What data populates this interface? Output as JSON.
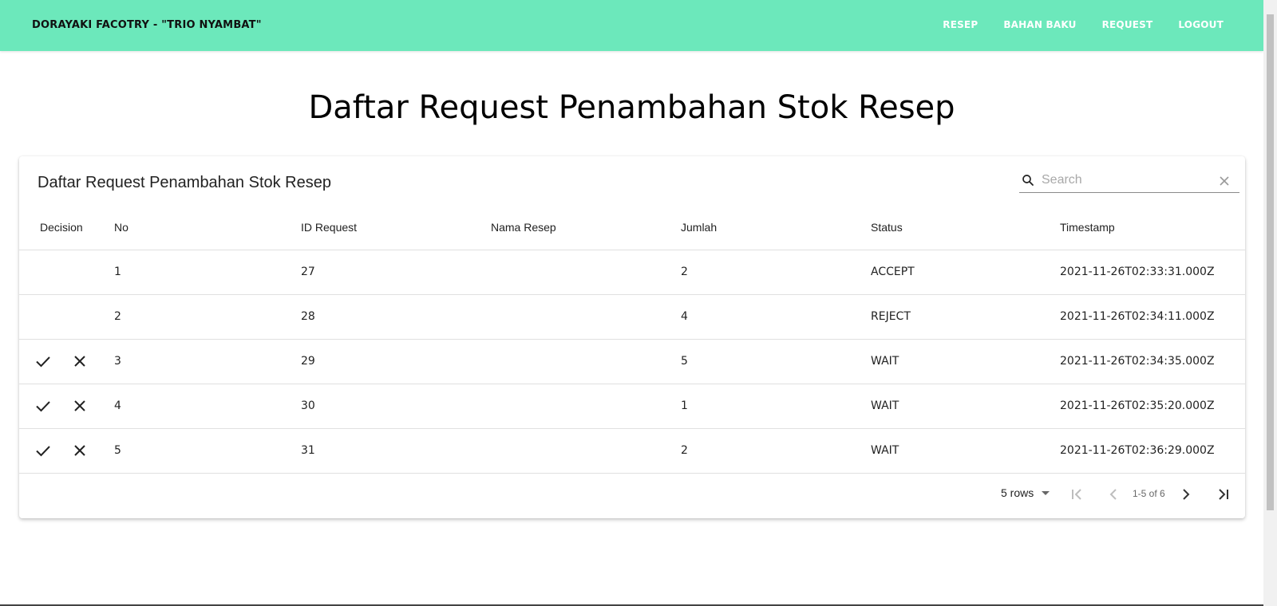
{
  "navbar": {
    "brand": "DORAYAKI FACOTRY - \"TRIO NYAMBAT\"",
    "links": [
      "RESEP",
      "BAHAN BAKU",
      "REQUEST",
      "LOGOUT"
    ]
  },
  "page_title": "Daftar Request Penambahan Stok Resep",
  "table": {
    "title": "Daftar Request Penambahan Stok Resep",
    "search_placeholder": "Search",
    "columns": [
      "Decision",
      "No",
      "ID Request",
      "Nama Resep",
      "Jumlah",
      "Status",
      "Timestamp"
    ],
    "rows": [
      {
        "no": "1",
        "id": "27",
        "nama": "",
        "jumlah": "2",
        "status": "ACCEPT",
        "timestamp": "2021-11-26T02:33:31.000Z",
        "actions": false
      },
      {
        "no": "2",
        "id": "28",
        "nama": "",
        "jumlah": "4",
        "status": "REJECT",
        "timestamp": "2021-11-26T02:34:11.000Z",
        "actions": false
      },
      {
        "no": "3",
        "id": "29",
        "nama": "",
        "jumlah": "5",
        "status": "WAIT",
        "timestamp": "2021-11-26T02:34:35.000Z",
        "actions": true
      },
      {
        "no": "4",
        "id": "30",
        "nama": "",
        "jumlah": "1",
        "status": "WAIT",
        "timestamp": "2021-11-26T02:35:20.000Z",
        "actions": true
      },
      {
        "no": "5",
        "id": "31",
        "nama": "",
        "jumlah": "2",
        "status": "WAIT",
        "timestamp": "2021-11-26T02:36:29.000Z",
        "actions": true
      }
    ]
  },
  "pagination": {
    "rows_label": "5 rows",
    "info": "1-5 of 6"
  },
  "colors": {
    "navbar_bg": "#6ce8bb",
    "nav_link": "#ffffff"
  }
}
